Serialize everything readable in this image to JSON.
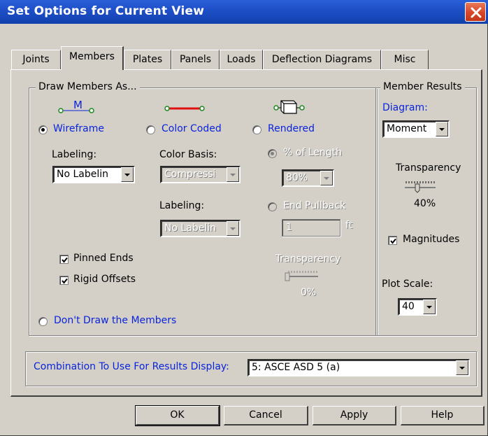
{
  "window": {
    "title": "Set Options for Current View"
  },
  "tabs": [
    {
      "label": "Joints",
      "active": false
    },
    {
      "label": "Members",
      "active": true
    },
    {
      "label": "Plates",
      "active": false
    },
    {
      "label": "Panels",
      "active": false
    },
    {
      "label": "Loads",
      "active": false
    },
    {
      "label": "Deflection Diagrams",
      "active": false
    },
    {
      "label": "Misc",
      "active": false
    }
  ],
  "draw_members": {
    "legend": "Draw Members As...",
    "wireframe": {
      "label": "Wireframe",
      "selected": true,
      "icon_label": "M"
    },
    "color_coded": {
      "label": "Color Coded",
      "selected": false
    },
    "rendered": {
      "label": "Rendered",
      "selected": false
    },
    "wireframe_labeling_label": "Labeling:",
    "wireframe_labeling_value": "No Labelin",
    "color_basis_label": "Color Basis:",
    "color_basis_value": "Compressi",
    "color_labeling_label": "Labeling:",
    "color_labeling_value": "No Labelin",
    "pct_of_length": {
      "label": "% of Length",
      "selected": true,
      "value": "80%"
    },
    "end_pullback": {
      "label": "End Pullback",
      "selected": false,
      "value": "1",
      "unit": "ft"
    },
    "pinned_ends": {
      "label": "Pinned Ends",
      "checked": true
    },
    "rigid_offsets": {
      "label": "Rigid Offsets",
      "checked": true
    },
    "transparency_label": "Transparency",
    "transparency_value": "0%",
    "dont_draw": {
      "label": "Don't Draw the Members",
      "selected": false
    }
  },
  "member_results": {
    "legend": "Member Results",
    "diagram_label": "Diagram:",
    "diagram_value": "Moment",
    "transparency_label": "Transparency",
    "transparency_value": "40%",
    "magnitudes": {
      "label": "Magnitudes",
      "checked": true
    },
    "plot_scale_label": "Plot Scale:",
    "plot_scale_value": "40"
  },
  "combination": {
    "label": "Combination To Use For Results Display:",
    "value": "5: ASCE ASD 5 (a)"
  },
  "buttons": {
    "ok": "OK",
    "cancel": "Cancel",
    "apply": "Apply",
    "help": "Help"
  },
  "colors": {
    "titlebar": "#1f50c8",
    "accent_blue": "#0a24dc",
    "color_coded_line": "#e01010",
    "node_green": "#1a8a1a"
  }
}
